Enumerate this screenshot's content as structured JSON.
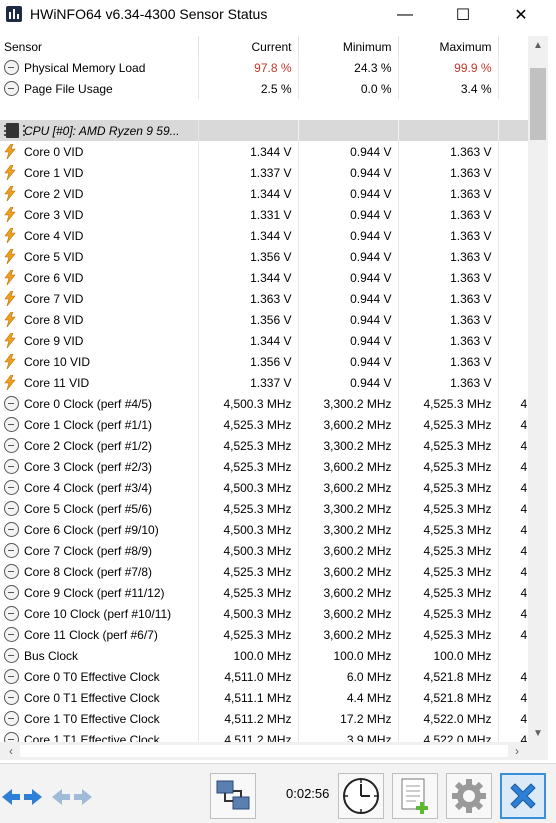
{
  "window": {
    "title": "HWiNFO64 v6.34-4300 Sensor Status",
    "minimize_glyph": "—",
    "maximize_glyph": "☐",
    "close_glyph": "✕"
  },
  "columns": {
    "sensor": "Sensor",
    "current": "Current",
    "minimum": "Minimum",
    "maximum": "Maximum"
  },
  "memory_rows": [
    {
      "name": "Physical Memory Load",
      "current": "97.8 %",
      "minimum": "24.3 %",
      "maximum": "99.9 %",
      "icon": "clock-icon",
      "alert": true
    },
    {
      "name": "Page File Usage",
      "current": "2.5 %",
      "minimum": "0.0 %",
      "maximum": "3.4 %",
      "icon": "clock-icon",
      "alert": false
    }
  ],
  "cpu_section": {
    "label": "CPU [#0]: AMD Ryzen 9 59...",
    "icon": "chip-icon"
  },
  "cpu_rows": [
    {
      "name": "Core 0 VID",
      "current": "1.344 V",
      "minimum": "0.944 V",
      "maximum": "1.363 V",
      "average": "",
      "icon": "bolt-icon"
    },
    {
      "name": "Core 1 VID",
      "current": "1.337 V",
      "minimum": "0.944 V",
      "maximum": "1.363 V",
      "average": "",
      "icon": "bolt-icon"
    },
    {
      "name": "Core 2 VID",
      "current": "1.344 V",
      "minimum": "0.944 V",
      "maximum": "1.363 V",
      "average": "",
      "icon": "bolt-icon"
    },
    {
      "name": "Core 3 VID",
      "current": "1.331 V",
      "minimum": "0.944 V",
      "maximum": "1.363 V",
      "average": "",
      "icon": "bolt-icon"
    },
    {
      "name": "Core 4 VID",
      "current": "1.344 V",
      "minimum": "0.944 V",
      "maximum": "1.363 V",
      "average": "",
      "icon": "bolt-icon"
    },
    {
      "name": "Core 5 VID",
      "current": "1.356 V",
      "minimum": "0.944 V",
      "maximum": "1.363 V",
      "average": "",
      "icon": "bolt-icon"
    },
    {
      "name": "Core 6 VID",
      "current": "1.344 V",
      "minimum": "0.944 V",
      "maximum": "1.363 V",
      "average": "",
      "icon": "bolt-icon"
    },
    {
      "name": "Core 7 VID",
      "current": "1.363 V",
      "minimum": "0.944 V",
      "maximum": "1.363 V",
      "average": "",
      "icon": "bolt-icon"
    },
    {
      "name": "Core 8 VID",
      "current": "1.356 V",
      "minimum": "0.944 V",
      "maximum": "1.363 V",
      "average": "",
      "icon": "bolt-icon"
    },
    {
      "name": "Core 9 VID",
      "current": "1.344 V",
      "minimum": "0.944 V",
      "maximum": "1.363 V",
      "average": "",
      "icon": "bolt-icon"
    },
    {
      "name": "Core 10 VID",
      "current": "1.356 V",
      "minimum": "0.944 V",
      "maximum": "1.363 V",
      "average": "",
      "icon": "bolt-icon"
    },
    {
      "name": "Core 11 VID",
      "current": "1.337 V",
      "minimum": "0.944 V",
      "maximum": "1.363 V",
      "average": "",
      "icon": "bolt-icon"
    },
    {
      "name": "Core 0 Clock (perf #4/5)",
      "current": "4,500.3 MHz",
      "minimum": "3,300.2 MHz",
      "maximum": "4,525.3 MHz",
      "average": "4",
      "icon": "clock-icon"
    },
    {
      "name": "Core 1 Clock (perf #1/1)",
      "current": "4,525.3 MHz",
      "minimum": "3,600.2 MHz",
      "maximum": "4,525.3 MHz",
      "average": "4",
      "icon": "clock-icon"
    },
    {
      "name": "Core 2 Clock (perf #1/2)",
      "current": "4,525.3 MHz",
      "minimum": "3,300.2 MHz",
      "maximum": "4,525.3 MHz",
      "average": "4",
      "icon": "clock-icon"
    },
    {
      "name": "Core 3 Clock (perf #2/3)",
      "current": "4,525.3 MHz",
      "minimum": "3,600.2 MHz",
      "maximum": "4,525.3 MHz",
      "average": "4",
      "icon": "clock-icon"
    },
    {
      "name": "Core 4 Clock (perf #3/4)",
      "current": "4,500.3 MHz",
      "minimum": "3,600.2 MHz",
      "maximum": "4,525.3 MHz",
      "average": "4",
      "icon": "clock-icon"
    },
    {
      "name": "Core 5 Clock (perf #5/6)",
      "current": "4,525.3 MHz",
      "minimum": "3,300.2 MHz",
      "maximum": "4,525.3 MHz",
      "average": "4",
      "icon": "clock-icon"
    },
    {
      "name": "Core 6 Clock (perf #9/10)",
      "current": "4,500.3 MHz",
      "minimum": "3,300.2 MHz",
      "maximum": "4,525.3 MHz",
      "average": "4",
      "icon": "clock-icon"
    },
    {
      "name": "Core 7 Clock (perf #8/9)",
      "current": "4,500.3 MHz",
      "minimum": "3,600.2 MHz",
      "maximum": "4,525.3 MHz",
      "average": "4",
      "icon": "clock-icon"
    },
    {
      "name": "Core 8 Clock (perf #7/8)",
      "current": "4,525.3 MHz",
      "minimum": "3,600.2 MHz",
      "maximum": "4,525.3 MHz",
      "average": "4",
      "icon": "clock-icon"
    },
    {
      "name": "Core 9 Clock (perf #11/12)",
      "current": "4,525.3 MHz",
      "minimum": "3,600.2 MHz",
      "maximum": "4,525.3 MHz",
      "average": "4",
      "icon": "clock-icon"
    },
    {
      "name": "Core 10 Clock (perf #10/11)",
      "current": "4,500.3 MHz",
      "minimum": "3,600.2 MHz",
      "maximum": "4,525.3 MHz",
      "average": "4",
      "icon": "clock-icon"
    },
    {
      "name": "Core 11 Clock (perf #6/7)",
      "current": "4,525.3 MHz",
      "minimum": "3,600.2 MHz",
      "maximum": "4,525.3 MHz",
      "average": "4",
      "icon": "clock-icon"
    },
    {
      "name": "Bus Clock",
      "current": "100.0 MHz",
      "minimum": "100.0 MHz",
      "maximum": "100.0 MHz",
      "average": "",
      "icon": "clock-icon"
    },
    {
      "name": "Core 0 T0 Effective Clock",
      "current": "4,511.0 MHz",
      "minimum": "6.0 MHz",
      "maximum": "4,521.8 MHz",
      "average": "4",
      "icon": "clock-icon"
    },
    {
      "name": "Core 0 T1 Effective Clock",
      "current": "4,511.1 MHz",
      "minimum": "4.4 MHz",
      "maximum": "4,521.8 MHz",
      "average": "4",
      "icon": "clock-icon"
    },
    {
      "name": "Core 1 T0 Effective Clock",
      "current": "4,511.2 MHz",
      "minimum": "17.2 MHz",
      "maximum": "4,522.0 MHz",
      "average": "4",
      "icon": "clock-icon"
    },
    {
      "name": "Core 1 T1 Effective Clock",
      "current": "4,511.2 MHz",
      "minimum": "3.9 MHz",
      "maximum": "4,522.0 MHz",
      "average": "4",
      "icon": "clock-icon"
    }
  ],
  "toolbar": {
    "elapsed_time": "0:02:56",
    "nav_icon": "arrows-icon",
    "nav_disabled_icon": "arrows-disabled-icon",
    "network_icon": "network-icon",
    "clock_icon": "clock-icon",
    "report_icon": "report-add-icon",
    "settings_icon": "gear-icon",
    "close_icon": "close-icon"
  },
  "colors": {
    "alert": "#c0392b",
    "section_bg": "#d9d9d9",
    "accent_blue": "#2e7fd6",
    "bolt_orange": "#f0a020"
  }
}
